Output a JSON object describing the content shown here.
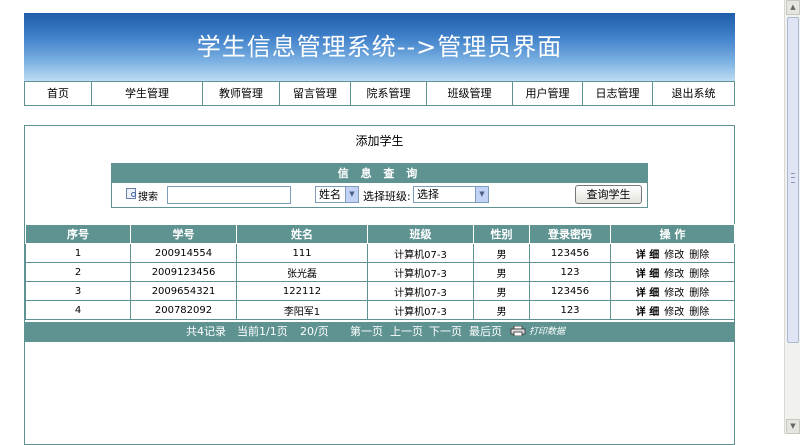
{
  "app": {
    "title": "学生信息管理系统-->管理员界面"
  },
  "nav": {
    "items": [
      "首页",
      "学生管理",
      "教师管理",
      "留言管理",
      "院系管理",
      "班级管理",
      "用户管理",
      "日志管理",
      "退出系统"
    ]
  },
  "page": {
    "heading": "添加学生"
  },
  "search": {
    "header": "信 息 查 询",
    "search_label": "搜索",
    "keyword_value": "",
    "field_select": "姓名",
    "class_label": "选择班级:",
    "class_select": "选择",
    "button_label": "查询学生"
  },
  "table": {
    "columns": [
      "序号",
      "学号",
      "姓名",
      "班级",
      "性别",
      "登录密码",
      "操 作"
    ],
    "rows": [
      {
        "index": "1",
        "student_id": "200914554",
        "name": "111",
        "class": "计算机07-3",
        "gender": "男",
        "password": "123456"
      },
      {
        "index": "2",
        "student_id": "2009123456",
        "name": "张光磊",
        "class": "计算机07-3",
        "gender": "男",
        "password": "123"
      },
      {
        "index": "3",
        "student_id": "2009654321",
        "name": "122112",
        "class": "计算机07-3",
        "gender": "男",
        "password": "123456"
      },
      {
        "index": "4",
        "student_id": "200782092",
        "name": "李阳军1",
        "class": "计算机07-3",
        "gender": "男",
        "password": "123"
      }
    ],
    "row_actions": {
      "detail": "详 细",
      "edit": "修改",
      "delete": "删除"
    }
  },
  "pager": {
    "total": "共4记录",
    "current": "当前1/1页",
    "per_page": "20/页",
    "first": "第一页",
    "prev": "上一页",
    "next": "下一页",
    "last": "最后页",
    "print": "打印数据"
  },
  "colors": {
    "accent": "#5f9391",
    "banner_top": "#1f5da9",
    "banner_bottom": "#bfdcf3"
  }
}
